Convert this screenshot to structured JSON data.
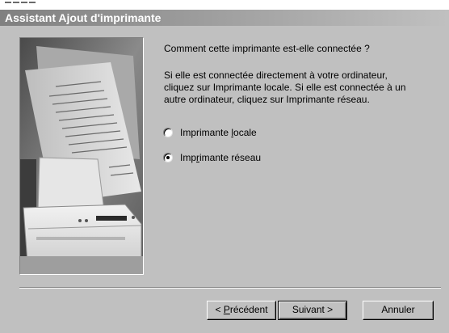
{
  "window": {
    "title": "Assistant Ajout d'imprimante"
  },
  "content": {
    "question": "Comment cette imprimante est-elle connectée ?",
    "paragraph_lines": [
      "Si elle est connectée directement à votre ordinateur,",
      "cliquez sur Imprimante locale. Si elle est connectée à un",
      "autre ordinateur, cliquez sur Imprimante réseau."
    ]
  },
  "options": [
    {
      "label_before": "Imprimante ",
      "label_access": "l",
      "label_after": "ocale",
      "checked": false
    },
    {
      "label_before": "Imp",
      "label_access": "r",
      "label_after": "imante réseau",
      "checked": true
    }
  ],
  "buttons": {
    "back": {
      "prefix": "< ",
      "access": "P",
      "rest": "récédent"
    },
    "next": "Suivant >",
    "cancel": "Annuler"
  },
  "illustration": {
    "icon": "printer-with-documents-illustration"
  }
}
